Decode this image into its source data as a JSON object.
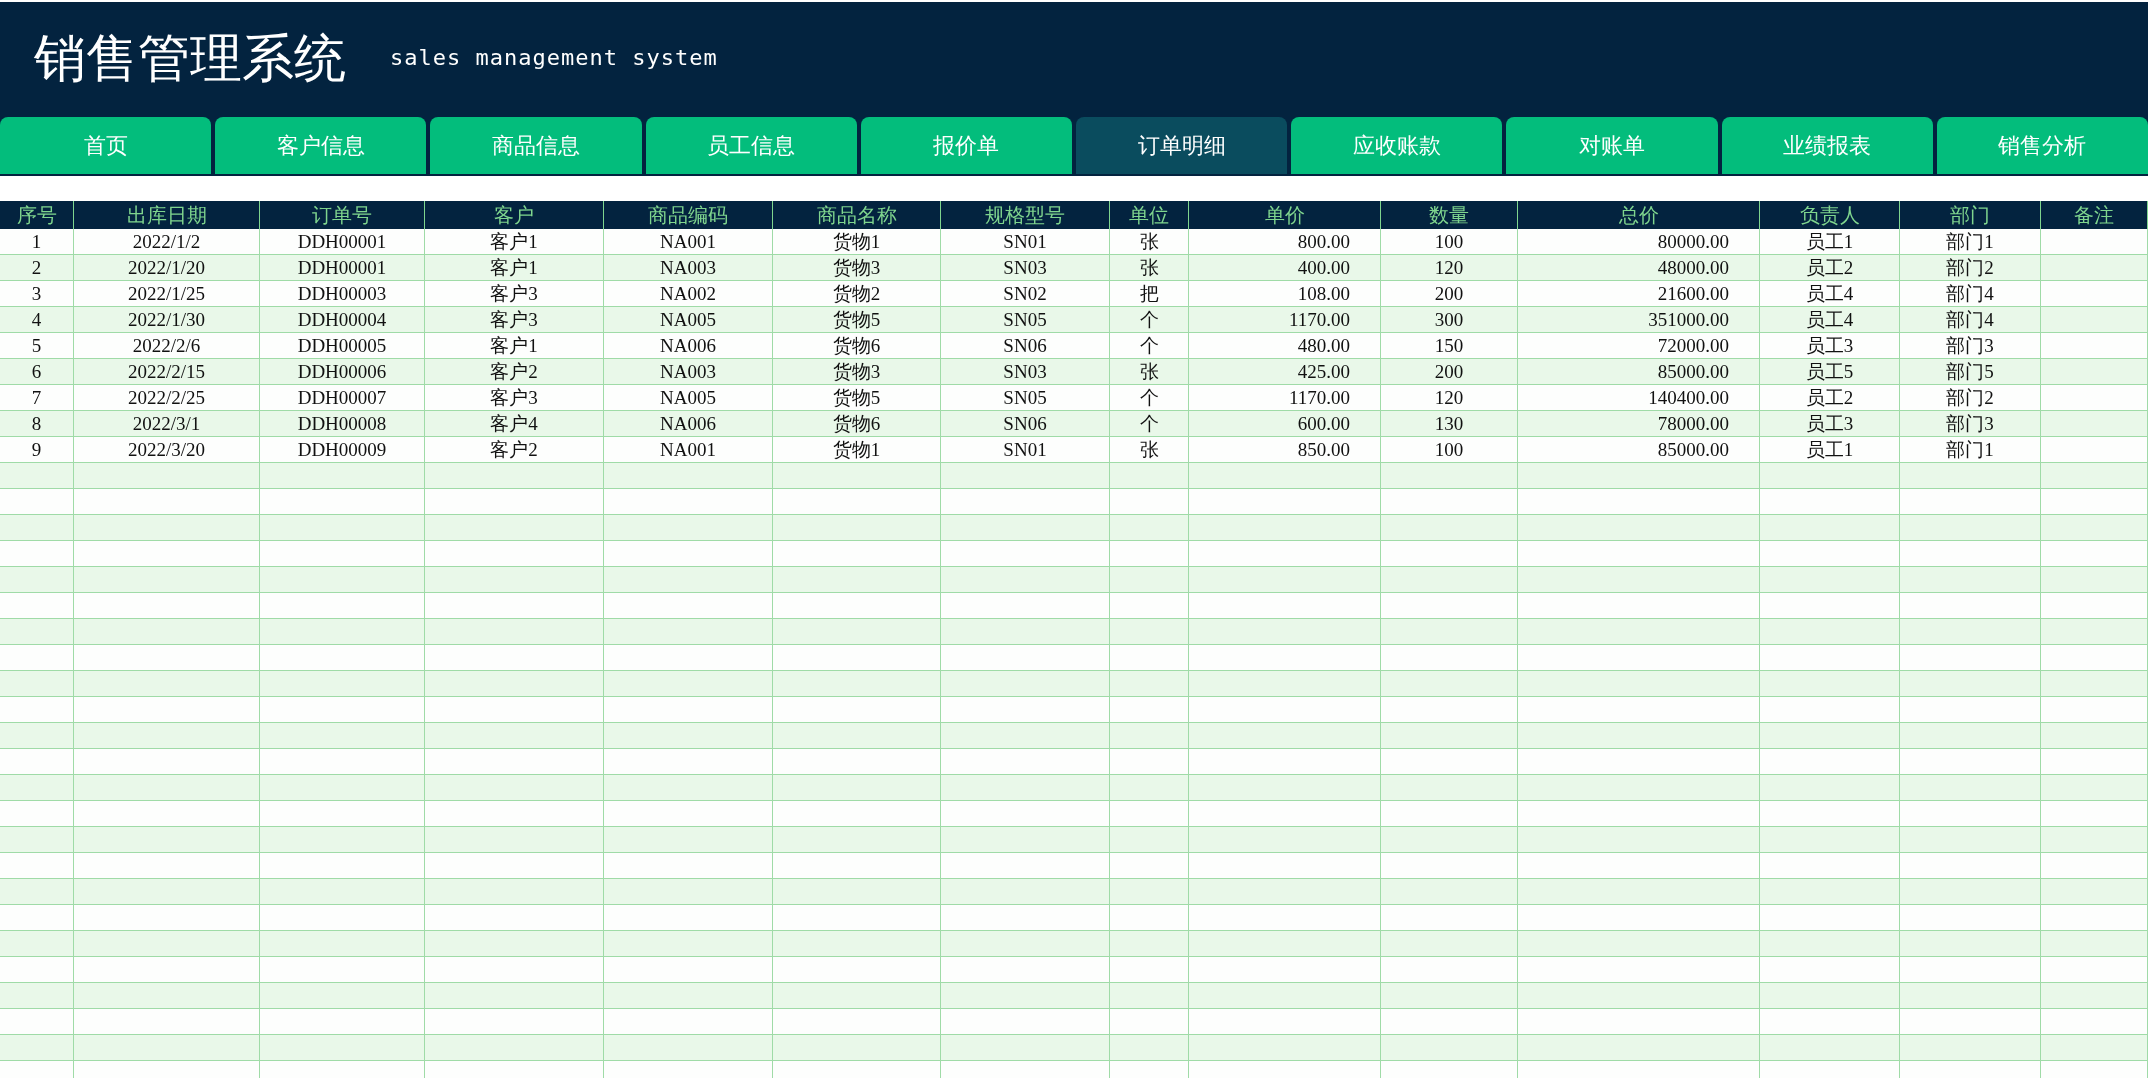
{
  "header": {
    "title": "销售管理系统",
    "subtitle": "sales management system"
  },
  "tabs": [
    {
      "label": "首页",
      "selected": false
    },
    {
      "label": "客户信息",
      "selected": false
    },
    {
      "label": "商品信息",
      "selected": false
    },
    {
      "label": "员工信息",
      "selected": false
    },
    {
      "label": "报价单",
      "selected": false
    },
    {
      "label": "订单明细",
      "selected": true
    },
    {
      "label": "应收账款",
      "selected": false
    },
    {
      "label": "对账单",
      "selected": false
    },
    {
      "label": "业绩报表",
      "selected": false
    },
    {
      "label": "销售分析",
      "selected": false
    }
  ],
  "table": {
    "columns": [
      "序号",
      "出库日期",
      "订单号",
      "客户",
      "商品编码",
      "商品名称",
      "规格型号",
      "单位",
      "单价",
      "数量",
      "总价",
      "负责人",
      "部门",
      "备注"
    ],
    "rows": [
      [
        "1",
        "2022/1/2",
        "DDH00001",
        "客户1",
        "NA001",
        "货物1",
        "SN01",
        "张",
        "800.00",
        "100",
        "80000.00",
        "员工1",
        "部门1"
      ],
      [
        "2",
        "2022/1/20",
        "DDH00001",
        "客户1",
        "NA003",
        "货物3",
        "SN03",
        "张",
        "400.00",
        "120",
        "48000.00",
        "员工2",
        "部门2"
      ],
      [
        "3",
        "2022/1/25",
        "DDH00003",
        "客户3",
        "NA002",
        "货物2",
        "SN02",
        "把",
        "108.00",
        "200",
        "21600.00",
        "员工4",
        "部门4"
      ],
      [
        "4",
        "2022/1/30",
        "DDH00004",
        "客户3",
        "NA005",
        "货物5",
        "SN05",
        "个",
        "1170.00",
        "300",
        "351000.00",
        "员工4",
        "部门4"
      ],
      [
        "5",
        "2022/2/6",
        "DDH00005",
        "客户1",
        "NA006",
        "货物6",
        "SN06",
        "个",
        "480.00",
        "150",
        "72000.00",
        "员工3",
        "部门3"
      ],
      [
        "6",
        "2022/2/15",
        "DDH00006",
        "客户2",
        "NA003",
        "货物3",
        "SN03",
        "张",
        "425.00",
        "200",
        "85000.00",
        "员工5",
        "部门5"
      ],
      [
        "7",
        "2022/2/25",
        "DDH00007",
        "客户3",
        "NA005",
        "货物5",
        "SN05",
        "个",
        "1170.00",
        "120",
        "140400.00",
        "员工2",
        "部门2"
      ],
      [
        "8",
        "2022/3/1",
        "DDH00008",
        "客户4",
        "NA006",
        "货物6",
        "SN06",
        "个",
        "600.00",
        "130",
        "78000.00",
        "员工3",
        "部门3"
      ],
      [
        "9",
        "2022/3/20",
        "DDH00009",
        "客户2",
        "NA001",
        "货物1",
        "SN01",
        "张",
        "850.00",
        "100",
        "85000.00",
        "员工1",
        "部门1"
      ]
    ]
  }
}
